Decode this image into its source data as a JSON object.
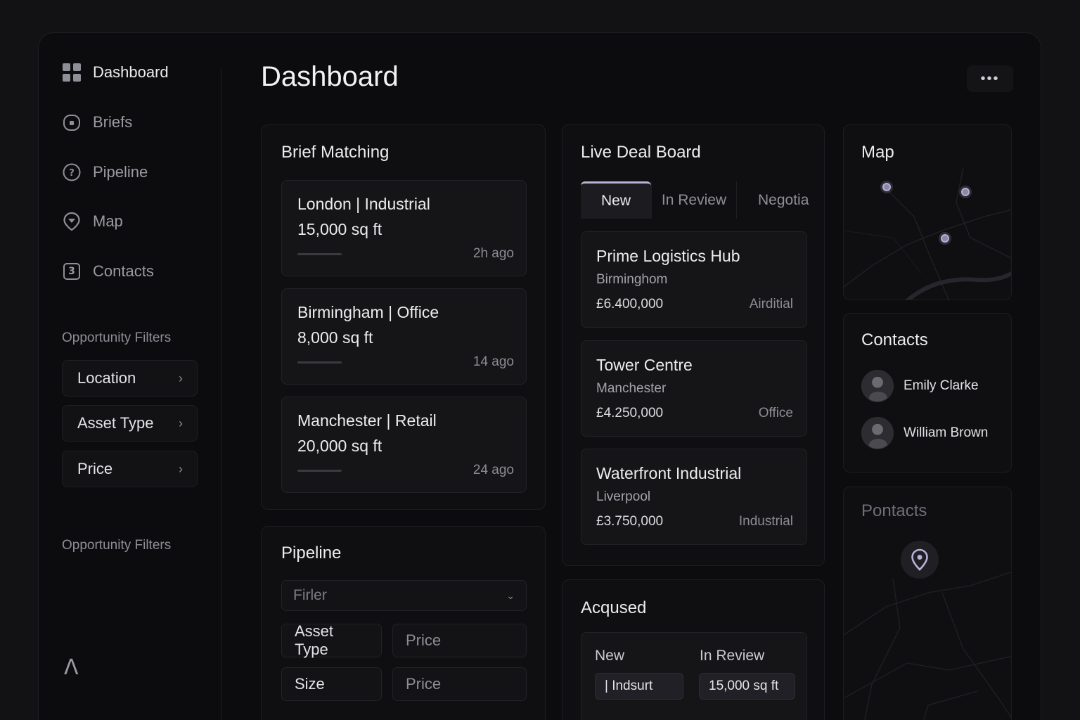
{
  "sidebar": {
    "nav": [
      {
        "label": "Dashboard",
        "icon": "grid-icon"
      },
      {
        "label": "Briefs",
        "icon": "briefcase-icon"
      },
      {
        "label": "Pipeline",
        "icon": "help-circle-icon"
      },
      {
        "label": "Map",
        "icon": "map-pin-icon"
      },
      {
        "label": "Contacts",
        "icon": "contacts-icon"
      }
    ],
    "contacts_badge": "3",
    "filters_label": "Opportunity Filters",
    "filters": [
      "Location",
      "Asset Type",
      "Price"
    ],
    "filters_label_2": "Opportunity Filters",
    "logo": "Λ"
  },
  "header": {
    "title": "Dashboard",
    "more": "•••"
  },
  "brief_matching": {
    "title": "Brief Matching",
    "cards": [
      {
        "line1": "London | Industrial",
        "line2": "15,000 sq ft",
        "time": "2h ago"
      },
      {
        "line1": "Birmingham | Office",
        "line2": "8,000 sq ft",
        "time": "14 ago"
      },
      {
        "line1": "Manchester | Retail",
        "line2": "20,000 sq ft",
        "time": "24 ago"
      }
    ]
  },
  "live_deal_board": {
    "title": "Live Deal Board",
    "tabs": [
      "New",
      "In Review",
      "Negotia"
    ],
    "active_tab": "New",
    "deals": [
      {
        "name": "Prime Logistics Hub",
        "city": "Birminghom",
        "price": "£6.400,000",
        "type": "Airditial"
      },
      {
        "name": "Tower Centre",
        "city": "Manchester",
        "price": "£4.250,000",
        "type": "Office"
      },
      {
        "name": "Waterfront Industrial",
        "city": "Liverpool",
        "price": "£3.750,000",
        "type": "Industrial"
      }
    ]
  },
  "map": {
    "title": "Map"
  },
  "contacts": {
    "title": "Contacts",
    "people": [
      {
        "name": "Emily Clarke"
      },
      {
        "name": "William Brown"
      }
    ]
  },
  "second_map": {
    "title": "Pontacts"
  },
  "pipeline": {
    "title": "Pipeline",
    "select_placeholder": "Firler",
    "chips": [
      {
        "label": "Asset Type",
        "muted": false
      },
      {
        "label": "Price",
        "muted": true
      },
      {
        "label": "Size",
        "muted": false
      },
      {
        "label": "Price",
        "muted": true
      }
    ]
  },
  "acquired": {
    "title": "Acqused",
    "columns": [
      {
        "header": "New",
        "value": "| Indsurt"
      },
      {
        "header": "In Review",
        "value": "15,000 sq ft"
      }
    ]
  },
  "colors": {
    "accent": "#b8b2d6",
    "background": "#0c0c0e",
    "card": "#151518"
  }
}
